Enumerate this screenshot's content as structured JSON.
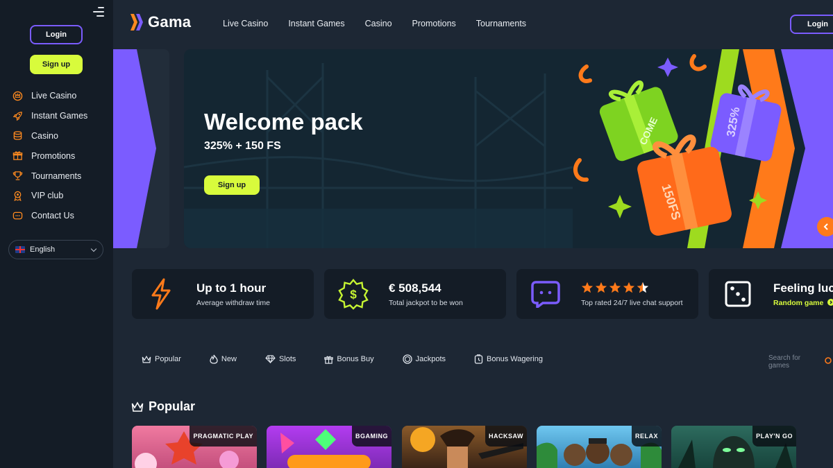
{
  "brand": {
    "name": "Gama",
    "accent_lime": "#d8fb3c",
    "accent_purple": "#7b5cff",
    "accent_orange": "#ff7a1a"
  },
  "sidebar": {
    "login_label": "Login",
    "signup_label": "Sign up",
    "items": [
      {
        "label": "Live Casino",
        "icon": "crown-circle-icon"
      },
      {
        "label": "Instant Games",
        "icon": "rocket-icon"
      },
      {
        "label": "Casino",
        "icon": "coins-stack-icon"
      },
      {
        "label": "Promotions",
        "icon": "gift-icon"
      },
      {
        "label": "Tournaments",
        "icon": "trophy-icon"
      },
      {
        "label": "VIP club",
        "icon": "medal-icon"
      },
      {
        "label": "Contact Us",
        "icon": "chat-icon"
      }
    ],
    "language": "English"
  },
  "header": {
    "nav": [
      "Live Casino",
      "Instant Games",
      "Casino",
      "Promotions",
      "Tournaments"
    ],
    "login_label": "Login"
  },
  "hero": {
    "title": "Welcome pack",
    "subtitle": "325% + 150 FS",
    "button_label": "Sign up",
    "gift_labels": [
      "COME",
      "325%",
      "150FS"
    ]
  },
  "stats": [
    {
      "title": "Up to 1 hour",
      "subtitle": "Average withdraw time",
      "icon": "lightning-icon"
    },
    {
      "title": "€ 508,544",
      "subtitle": "Total jackpot to be won",
      "icon": "dollar-badge-icon"
    },
    {
      "rating": 4.5,
      "subtitle": "Top rated 24/7 live chat support",
      "icon": "chat-bubble-icon"
    },
    {
      "title": "Feeling luc",
      "subtitle": "Random game",
      "icon": "dice-icon"
    }
  ],
  "categories": [
    {
      "label": "Popular",
      "icon": "crown-icon"
    },
    {
      "label": "New",
      "icon": "flame-icon"
    },
    {
      "label": "Slots",
      "icon": "diamond-icon"
    },
    {
      "label": "Bonus Buy",
      "icon": "gift-icon"
    },
    {
      "label": "Jackpots",
      "icon": "coin-icon"
    },
    {
      "label": "Bonus Wagering",
      "icon": "clock-icon"
    }
  ],
  "search": {
    "placeholder": "Search for games"
  },
  "popular": {
    "title": "Popular",
    "games": [
      {
        "provider": "PRAGMATIC PLAY",
        "bg": "#c44f7d"
      },
      {
        "provider": "BGAMING",
        "bg": "#7d2bb5"
      },
      {
        "provider": "HACKSAW",
        "bg": "#5a3520"
      },
      {
        "provider": "RELAX",
        "bg": "#2f7fb3"
      },
      {
        "provider": "PLAY'N GO",
        "bg": "#17443c"
      }
    ]
  }
}
